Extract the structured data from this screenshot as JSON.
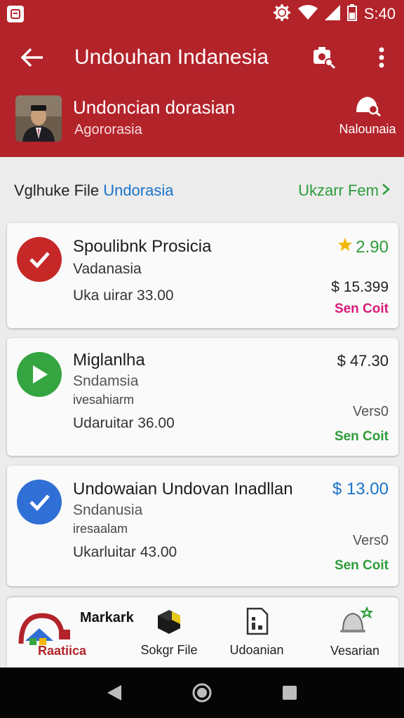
{
  "status_bar": {
    "app_icon": "message-icon",
    "time": "S:40",
    "icons": [
      "settings-icon",
      "wifi-icon",
      "signal-icon",
      "battery-icon"
    ]
  },
  "app_bar": {
    "title": "Undouhan Indanesia",
    "icons": [
      "back-arrow-icon",
      "search-camera-icon",
      "more-vert-icon"
    ],
    "profile_name": "Undoncian dorasian",
    "profile_sub": "Agororasia",
    "notification_label": "Nalounaia"
  },
  "section": {
    "title_prefix": "Vglhuke File",
    "title_accent": "Undorasia",
    "link_label": "Ukzarr Fem"
  },
  "cards": [
    {
      "title": "Spoulibnk Prosicia",
      "subtitle": "Vadanasia",
      "meta": "Uka uirar 33.00",
      "rating": "2.90",
      "price": "$ 15.399",
      "action": "Sen Coit",
      "icon": "check-icon"
    },
    {
      "title": "Miglanlha",
      "subtitle": "Sndamsia",
      "subtitle2": "ivesahiarm",
      "meta": "Udaruitar 36.00",
      "price": "$ 47.30",
      "version": "Vers0",
      "action": "Sen Coit",
      "icon": "play-icon"
    },
    {
      "title": "Undowaian Undovan Inadllan",
      "subtitle": "Sndanusia",
      "subtitle2": "iresaalam",
      "meta": "Ukarluitar 43.00",
      "price": "$ 13.00",
      "version": "Vers0",
      "action": "Sen Coit",
      "icon": "check-icon"
    }
  ],
  "bottom_nav": {
    "home_title": "Markark",
    "home_label": "Raatiica",
    "items": [
      {
        "label": "Sokgr File",
        "icon": "cube-icon"
      },
      {
        "label": "Udoanian",
        "icon": "document-icon"
      },
      {
        "label": "Vesarian",
        "icon": "bell-icon"
      }
    ]
  },
  "colors": {
    "brand_red": "#b3232a",
    "accent_blue": "#1a73c8",
    "accent_green": "#2e9c3a",
    "accent_pink": "#d81b7a",
    "rating_star": "#f2b705"
  }
}
